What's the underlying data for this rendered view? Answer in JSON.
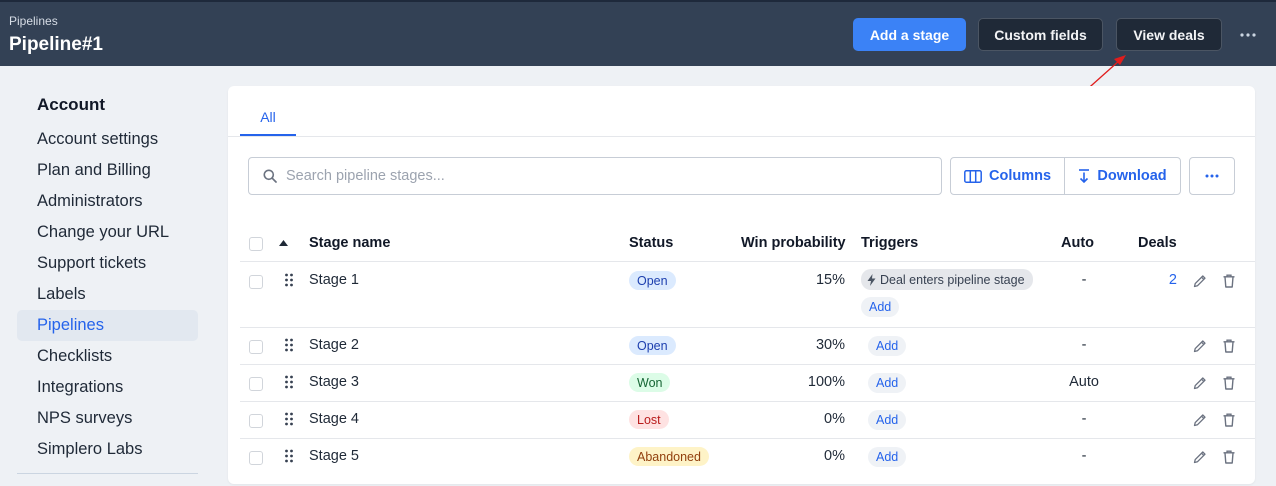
{
  "header": {
    "breadcrumb": "Pipelines",
    "title": "Pipeline#1",
    "add_stage": "Add a stage",
    "custom_fields": "Custom fields",
    "view_deals": "View deals",
    "more_icon": "more-horizontal-icon"
  },
  "sidebar": {
    "heading": "Account",
    "items": [
      {
        "label": "Account settings"
      },
      {
        "label": "Plan and Billing"
      },
      {
        "label": "Administrators"
      },
      {
        "label": "Change your URL"
      },
      {
        "label": "Support tickets"
      },
      {
        "label": "Labels"
      },
      {
        "label": "Pipelines",
        "active": true
      },
      {
        "label": "Checklists"
      },
      {
        "label": "Integrations"
      },
      {
        "label": "NPS surveys"
      },
      {
        "label": "Simplero Labs"
      }
    ]
  },
  "main": {
    "tabs": [
      {
        "label": "All"
      }
    ],
    "search": {
      "placeholder": "Search pipeline stages...",
      "value": ""
    },
    "columns_btn": "Columns",
    "download_btn": "Download",
    "table": {
      "headers": {
        "stage": "Stage name",
        "status": "Status",
        "win": "Win probability",
        "triggers": "Triggers",
        "auto": "Auto",
        "deals": "Deals"
      },
      "rows": [
        {
          "name": "Stage 1",
          "status": "Open",
          "win": "15%",
          "trigger": "Deal enters pipeline stage",
          "add": "Add",
          "auto": "-",
          "deals": "2"
        },
        {
          "name": "Stage 2",
          "status": "Open",
          "win": "30%",
          "add": "Add",
          "auto": "-",
          "deals": ""
        },
        {
          "name": "Stage 3",
          "status": "Won",
          "win": "100%",
          "add": "Add",
          "auto": "Auto",
          "deals": ""
        },
        {
          "name": "Stage 4",
          "status": "Lost",
          "win": "0%",
          "add": "Add",
          "auto": "-",
          "deals": ""
        },
        {
          "name": "Stage 5",
          "status": "Abandoned",
          "win": "0%",
          "add": "Add",
          "auto": "-",
          "deals": ""
        }
      ]
    }
  },
  "colors": {
    "primary": "#3b82f6",
    "header_bg": "#334155",
    "link": "#2563eb",
    "annotation_arrow": "#e11d1d"
  }
}
